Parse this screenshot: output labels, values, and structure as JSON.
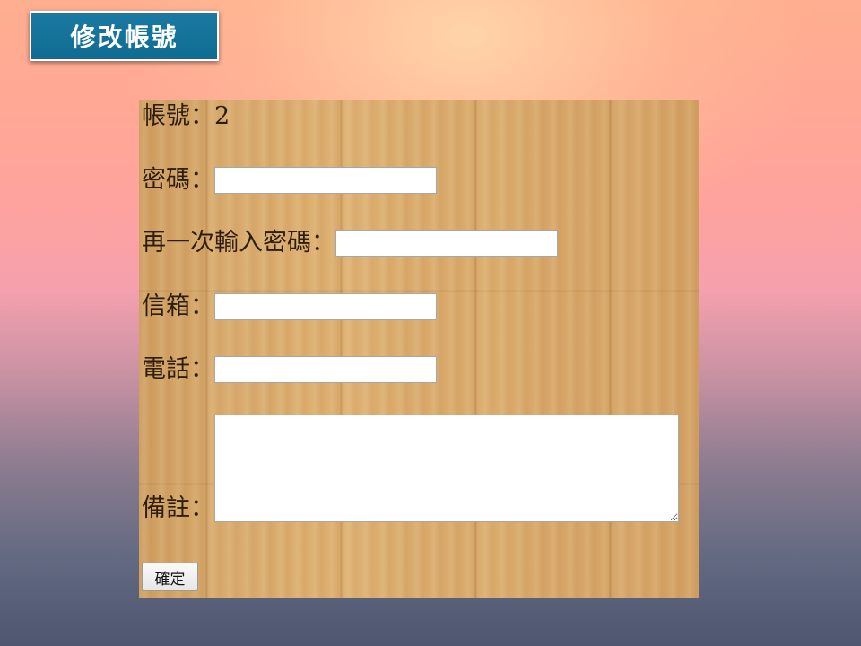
{
  "slide": {
    "title": "修改帳號"
  },
  "form": {
    "account_label": "帳號：",
    "account_value": "2",
    "password_label": "密碼：",
    "password_value": "",
    "confirm_password_label": "再一次輸入密碼：",
    "confirm_password_value": "",
    "email_label": "信箱：",
    "email_value": "",
    "phone_label": "電話：",
    "phone_value": "",
    "note_label": "備註：",
    "note_value": "",
    "submit_label": "確定"
  },
  "colors": {
    "title_bg": "#0f6b91",
    "title_text": "#ffffff",
    "panel_wood": "#d7a86a"
  }
}
